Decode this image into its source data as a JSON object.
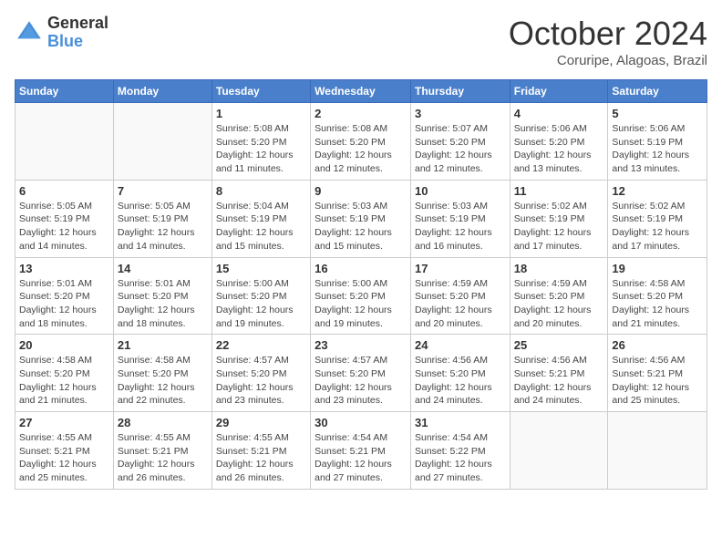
{
  "logo": {
    "general": "General",
    "blue": "Blue"
  },
  "title": "October 2024",
  "subtitle": "Coruripe, Alagoas, Brazil",
  "days_of_week": [
    "Sunday",
    "Monday",
    "Tuesday",
    "Wednesday",
    "Thursday",
    "Friday",
    "Saturday"
  ],
  "weeks": [
    [
      {
        "day": "",
        "info": ""
      },
      {
        "day": "",
        "info": ""
      },
      {
        "day": "1",
        "info": "Sunrise: 5:08 AM\nSunset: 5:20 PM\nDaylight: 12 hours and 11 minutes."
      },
      {
        "day": "2",
        "info": "Sunrise: 5:08 AM\nSunset: 5:20 PM\nDaylight: 12 hours and 12 minutes."
      },
      {
        "day": "3",
        "info": "Sunrise: 5:07 AM\nSunset: 5:20 PM\nDaylight: 12 hours and 12 minutes."
      },
      {
        "day": "4",
        "info": "Sunrise: 5:06 AM\nSunset: 5:20 PM\nDaylight: 12 hours and 13 minutes."
      },
      {
        "day": "5",
        "info": "Sunrise: 5:06 AM\nSunset: 5:19 PM\nDaylight: 12 hours and 13 minutes."
      }
    ],
    [
      {
        "day": "6",
        "info": "Sunrise: 5:05 AM\nSunset: 5:19 PM\nDaylight: 12 hours and 14 minutes."
      },
      {
        "day": "7",
        "info": "Sunrise: 5:05 AM\nSunset: 5:19 PM\nDaylight: 12 hours and 14 minutes."
      },
      {
        "day": "8",
        "info": "Sunrise: 5:04 AM\nSunset: 5:19 PM\nDaylight: 12 hours and 15 minutes."
      },
      {
        "day": "9",
        "info": "Sunrise: 5:03 AM\nSunset: 5:19 PM\nDaylight: 12 hours and 15 minutes."
      },
      {
        "day": "10",
        "info": "Sunrise: 5:03 AM\nSunset: 5:19 PM\nDaylight: 12 hours and 16 minutes."
      },
      {
        "day": "11",
        "info": "Sunrise: 5:02 AM\nSunset: 5:19 PM\nDaylight: 12 hours and 17 minutes."
      },
      {
        "day": "12",
        "info": "Sunrise: 5:02 AM\nSunset: 5:19 PM\nDaylight: 12 hours and 17 minutes."
      }
    ],
    [
      {
        "day": "13",
        "info": "Sunrise: 5:01 AM\nSunset: 5:20 PM\nDaylight: 12 hours and 18 minutes."
      },
      {
        "day": "14",
        "info": "Sunrise: 5:01 AM\nSunset: 5:20 PM\nDaylight: 12 hours and 18 minutes."
      },
      {
        "day": "15",
        "info": "Sunrise: 5:00 AM\nSunset: 5:20 PM\nDaylight: 12 hours and 19 minutes."
      },
      {
        "day": "16",
        "info": "Sunrise: 5:00 AM\nSunset: 5:20 PM\nDaylight: 12 hours and 19 minutes."
      },
      {
        "day": "17",
        "info": "Sunrise: 4:59 AM\nSunset: 5:20 PM\nDaylight: 12 hours and 20 minutes."
      },
      {
        "day": "18",
        "info": "Sunrise: 4:59 AM\nSunset: 5:20 PM\nDaylight: 12 hours and 20 minutes."
      },
      {
        "day": "19",
        "info": "Sunrise: 4:58 AM\nSunset: 5:20 PM\nDaylight: 12 hours and 21 minutes."
      }
    ],
    [
      {
        "day": "20",
        "info": "Sunrise: 4:58 AM\nSunset: 5:20 PM\nDaylight: 12 hours and 21 minutes."
      },
      {
        "day": "21",
        "info": "Sunrise: 4:58 AM\nSunset: 5:20 PM\nDaylight: 12 hours and 22 minutes."
      },
      {
        "day": "22",
        "info": "Sunrise: 4:57 AM\nSunset: 5:20 PM\nDaylight: 12 hours and 23 minutes."
      },
      {
        "day": "23",
        "info": "Sunrise: 4:57 AM\nSunset: 5:20 PM\nDaylight: 12 hours and 23 minutes."
      },
      {
        "day": "24",
        "info": "Sunrise: 4:56 AM\nSunset: 5:20 PM\nDaylight: 12 hours and 24 minutes."
      },
      {
        "day": "25",
        "info": "Sunrise: 4:56 AM\nSunset: 5:21 PM\nDaylight: 12 hours and 24 minutes."
      },
      {
        "day": "26",
        "info": "Sunrise: 4:56 AM\nSunset: 5:21 PM\nDaylight: 12 hours and 25 minutes."
      }
    ],
    [
      {
        "day": "27",
        "info": "Sunrise: 4:55 AM\nSunset: 5:21 PM\nDaylight: 12 hours and 25 minutes."
      },
      {
        "day": "28",
        "info": "Sunrise: 4:55 AM\nSunset: 5:21 PM\nDaylight: 12 hours and 26 minutes."
      },
      {
        "day": "29",
        "info": "Sunrise: 4:55 AM\nSunset: 5:21 PM\nDaylight: 12 hours and 26 minutes."
      },
      {
        "day": "30",
        "info": "Sunrise: 4:54 AM\nSunset: 5:21 PM\nDaylight: 12 hours and 27 minutes."
      },
      {
        "day": "31",
        "info": "Sunrise: 4:54 AM\nSunset: 5:22 PM\nDaylight: 12 hours and 27 minutes."
      },
      {
        "day": "",
        "info": ""
      },
      {
        "day": "",
        "info": ""
      }
    ]
  ]
}
